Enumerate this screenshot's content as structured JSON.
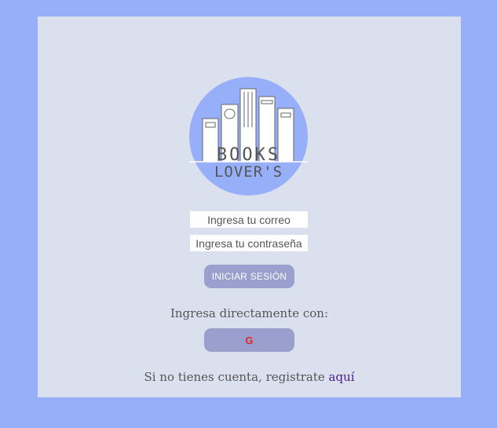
{
  "logo": {
    "line1": "BOOKS",
    "line2": "LOVER'S",
    "circle_color": "#97aef8"
  },
  "form": {
    "email_placeholder": "Ingresa tu correo",
    "password_placeholder": "Ingresa tu contraseña",
    "login_label": "INICIAR SESIÓN"
  },
  "social": {
    "heading": "Ingresa directamente con:",
    "google_glyph": "G",
    "google_icon": "google-icon"
  },
  "register": {
    "text": "Si no tienes cuenta, registrate ",
    "link": "aquí"
  },
  "colors": {
    "page_bg": "#97aef8",
    "card_bg": "#dbe0ef",
    "button_bg": "#9a9fcd",
    "link": "#4b1a8a",
    "google_red": "#e0262b"
  }
}
